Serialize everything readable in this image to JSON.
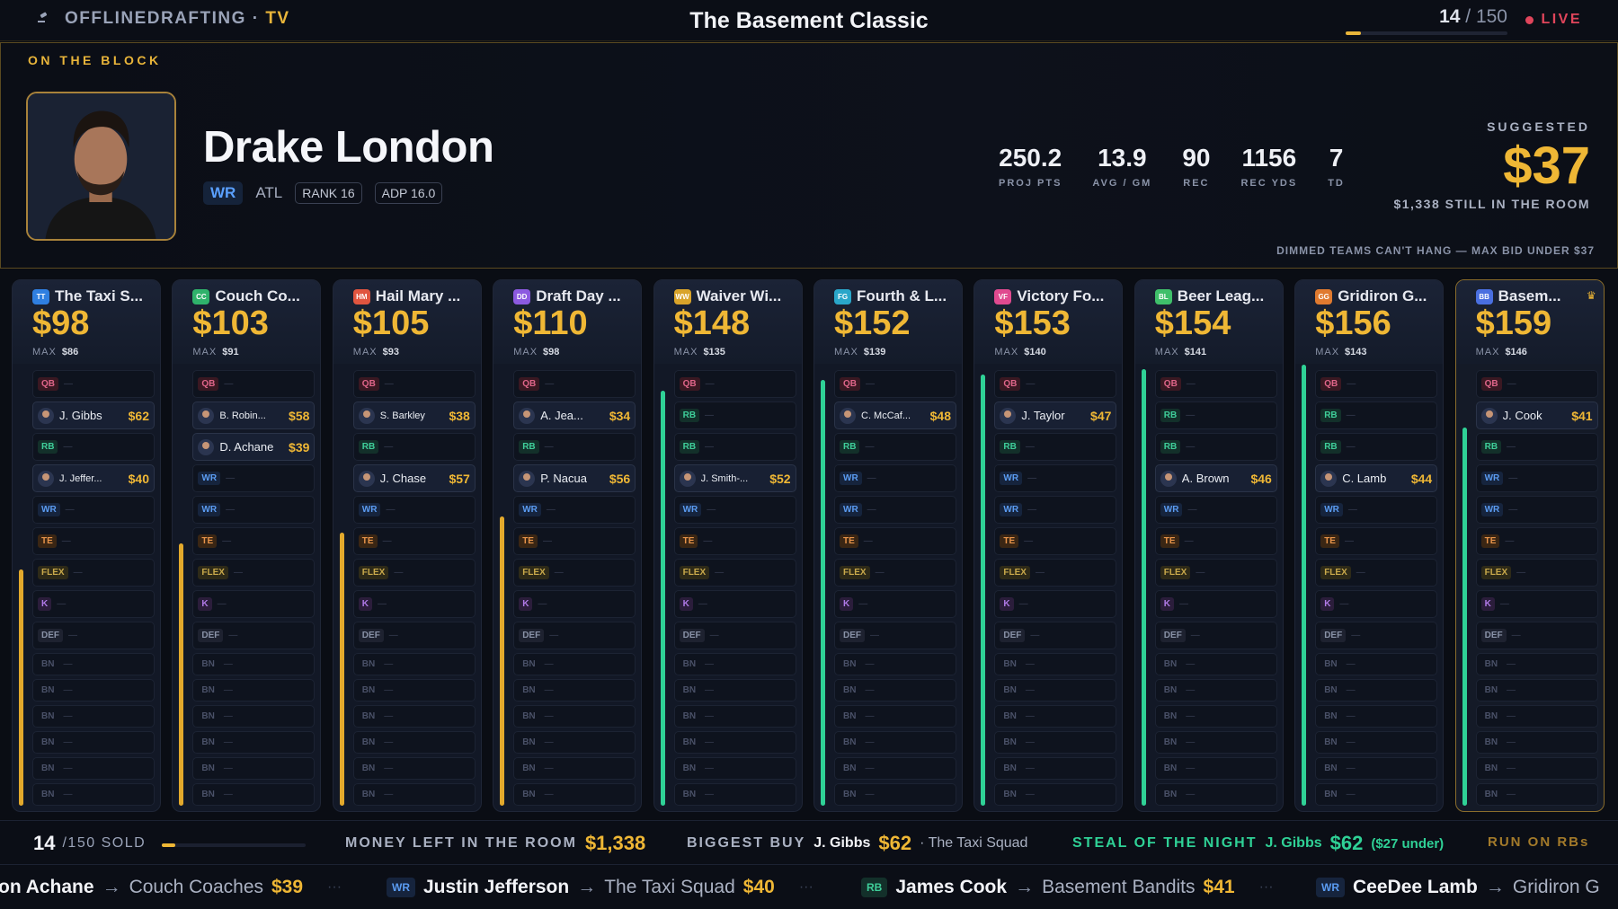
{
  "header": {
    "brand": "OFFLINEDRAFTING",
    "brand_sep": " · ",
    "brand_tv": "TV",
    "title": "The Basement Classic",
    "pick": "14",
    "pick_total": "/ 150",
    "pick_progress": 0.093,
    "live": "LIVE"
  },
  "block": {
    "label": "ON THE BLOCK",
    "player": "Drake London",
    "position": "WR",
    "team": "ATL",
    "rank": "RANK 16",
    "adp": "ADP 16.0",
    "stats": [
      {
        "value": "250.2",
        "label": "PROJ PTS"
      },
      {
        "value": "13.9",
        "label": "AVG / GM"
      },
      {
        "value": "90",
        "label": "REC"
      },
      {
        "value": "1156",
        "label": "REC YDS"
      },
      {
        "value": "7",
        "label": "TD"
      }
    ],
    "suggested_label": "SUGGESTED",
    "suggested": "$37",
    "room": "$1,338 STILL IN THE ROOM",
    "dim_note": "DIMMED TEAMS CAN'T HANG — MAX BID UNDER $37"
  },
  "teams": [
    {
      "abbr": "TT",
      "color": "#2f7fe0",
      "name": "The Taxi S...",
      "budget": "$98",
      "max": "$86",
      "bar": "gold",
      "bar_fill": 0.45,
      "mine": false,
      "slots": [
        {
          "pos": "QB"
        },
        {
          "pos": "RB",
          "player": "J. Gibbs",
          "price": "$62"
        },
        {
          "pos": "RB"
        },
        {
          "pos": "WR",
          "player": "J. Jeffer...",
          "price": "$40",
          "small": true
        },
        {
          "pos": "WR"
        },
        {
          "pos": "TE"
        },
        {
          "pos": "FLEX"
        },
        {
          "pos": "K"
        },
        {
          "pos": "DEF"
        },
        {
          "pos": "BN"
        },
        {
          "pos": "BN"
        },
        {
          "pos": "BN"
        },
        {
          "pos": "BN"
        },
        {
          "pos": "BN"
        },
        {
          "pos": "BN"
        }
      ]
    },
    {
      "abbr": "CC",
      "color": "#2fb26b",
      "name": "Couch Co...",
      "budget": "$103",
      "max": "$91",
      "bar": "gold",
      "bar_fill": 0.5,
      "mine": false,
      "slots": [
        {
          "pos": "QB"
        },
        {
          "pos": "RB",
          "player": "B. Robin...",
          "price": "$58",
          "small": true
        },
        {
          "pos": "RB",
          "player": "D. Achane",
          "price": "$39"
        },
        {
          "pos": "WR"
        },
        {
          "pos": "WR"
        },
        {
          "pos": "TE"
        },
        {
          "pos": "FLEX"
        },
        {
          "pos": "K"
        },
        {
          "pos": "DEF"
        },
        {
          "pos": "BN"
        },
        {
          "pos": "BN"
        },
        {
          "pos": "BN"
        },
        {
          "pos": "BN"
        },
        {
          "pos": "BN"
        },
        {
          "pos": "BN"
        }
      ]
    },
    {
      "abbr": "HM",
      "color": "#e0553f",
      "name": "Hail Mary ...",
      "budget": "$105",
      "max": "$93",
      "bar": "gold",
      "bar_fill": 0.52,
      "mine": false,
      "slots": [
        {
          "pos": "QB"
        },
        {
          "pos": "RB",
          "player": "S. Barkley",
          "price": "$38",
          "small": true
        },
        {
          "pos": "RB"
        },
        {
          "pos": "WR",
          "player": "J. Chase",
          "price": "$57"
        },
        {
          "pos": "WR"
        },
        {
          "pos": "TE"
        },
        {
          "pos": "FLEX"
        },
        {
          "pos": "K"
        },
        {
          "pos": "DEF"
        },
        {
          "pos": "BN"
        },
        {
          "pos": "BN"
        },
        {
          "pos": "BN"
        },
        {
          "pos": "BN"
        },
        {
          "pos": "BN"
        },
        {
          "pos": "BN"
        }
      ]
    },
    {
      "abbr": "DD",
      "color": "#8c5ae0",
      "name": "Draft Day ...",
      "budget": "$110",
      "max": "$98",
      "bar": "gold",
      "bar_fill": 0.55,
      "mine": false,
      "slots": [
        {
          "pos": "QB"
        },
        {
          "pos": "WR",
          "player": "A. Jea...",
          "price": "$34"
        },
        {
          "pos": "RB"
        },
        {
          "pos": "WR",
          "player": "P. Nacua",
          "price": "$56"
        },
        {
          "pos": "WR"
        },
        {
          "pos": "TE"
        },
        {
          "pos": "FLEX"
        },
        {
          "pos": "K"
        },
        {
          "pos": "DEF"
        },
        {
          "pos": "BN"
        },
        {
          "pos": "BN"
        },
        {
          "pos": "BN"
        },
        {
          "pos": "BN"
        },
        {
          "pos": "BN"
        },
        {
          "pos": "BN"
        }
      ]
    },
    {
      "abbr": "WW",
      "color": "#d9a42a",
      "name": "Waiver Wi...",
      "budget": "$148",
      "max": "$135",
      "bar": "green",
      "bar_fill": 0.79,
      "mine": false,
      "slots": [
        {
          "pos": "QB"
        },
        {
          "pos": "RB"
        },
        {
          "pos": "RB"
        },
        {
          "pos": "WR",
          "player": "J. Smith-...",
          "price": "$52",
          "small": true
        },
        {
          "pos": "WR"
        },
        {
          "pos": "TE"
        },
        {
          "pos": "FLEX"
        },
        {
          "pos": "K"
        },
        {
          "pos": "DEF"
        },
        {
          "pos": "BN"
        },
        {
          "pos": "BN"
        },
        {
          "pos": "BN"
        },
        {
          "pos": "BN"
        },
        {
          "pos": "BN"
        },
        {
          "pos": "BN"
        }
      ]
    },
    {
      "abbr": "FG",
      "color": "#2aa6c9",
      "name": "Fourth & L...",
      "budget": "$152",
      "max": "$139",
      "bar": "green",
      "bar_fill": 0.81,
      "mine": false,
      "slots": [
        {
          "pos": "QB"
        },
        {
          "pos": "RB",
          "player": "C. McCaf...",
          "price": "$48",
          "small": true
        },
        {
          "pos": "RB"
        },
        {
          "pos": "WR"
        },
        {
          "pos": "WR"
        },
        {
          "pos": "TE"
        },
        {
          "pos": "FLEX"
        },
        {
          "pos": "K"
        },
        {
          "pos": "DEF"
        },
        {
          "pos": "BN"
        },
        {
          "pos": "BN"
        },
        {
          "pos": "BN"
        },
        {
          "pos": "BN"
        },
        {
          "pos": "BN"
        },
        {
          "pos": "BN"
        }
      ]
    },
    {
      "abbr": "VF",
      "color": "#e04a8f",
      "name": "Victory Fo...",
      "budget": "$153",
      "max": "$140",
      "bar": "green",
      "bar_fill": 0.82,
      "mine": false,
      "slots": [
        {
          "pos": "QB"
        },
        {
          "pos": "RB",
          "player": "J. Taylor",
          "price": "$47"
        },
        {
          "pos": "RB"
        },
        {
          "pos": "WR"
        },
        {
          "pos": "WR"
        },
        {
          "pos": "TE"
        },
        {
          "pos": "FLEX"
        },
        {
          "pos": "K"
        },
        {
          "pos": "DEF"
        },
        {
          "pos": "BN"
        },
        {
          "pos": "BN"
        },
        {
          "pos": "BN"
        },
        {
          "pos": "BN"
        },
        {
          "pos": "BN"
        },
        {
          "pos": "BN"
        }
      ]
    },
    {
      "abbr": "BL",
      "color": "#3fbf6a",
      "name": "Beer Leag...",
      "budget": "$154",
      "max": "$141",
      "bar": "green",
      "bar_fill": 0.83,
      "mine": false,
      "slots": [
        {
          "pos": "QB"
        },
        {
          "pos": "RB"
        },
        {
          "pos": "RB"
        },
        {
          "pos": "WR",
          "player": "A. Brown",
          "price": "$46"
        },
        {
          "pos": "WR"
        },
        {
          "pos": "TE"
        },
        {
          "pos": "FLEX"
        },
        {
          "pos": "K"
        },
        {
          "pos": "DEF"
        },
        {
          "pos": "BN"
        },
        {
          "pos": "BN"
        },
        {
          "pos": "BN"
        },
        {
          "pos": "BN"
        },
        {
          "pos": "BN"
        },
        {
          "pos": "BN"
        }
      ]
    },
    {
      "abbr": "GG",
      "color": "#e07a2f",
      "name": "Gridiron G...",
      "budget": "$156",
      "max": "$143",
      "bar": "green",
      "bar_fill": 0.84,
      "mine": false,
      "slots": [
        {
          "pos": "QB"
        },
        {
          "pos": "RB"
        },
        {
          "pos": "RB"
        },
        {
          "pos": "WR",
          "player": "C. Lamb",
          "price": "$44"
        },
        {
          "pos": "WR"
        },
        {
          "pos": "TE"
        },
        {
          "pos": "FLEX"
        },
        {
          "pos": "K"
        },
        {
          "pos": "DEF"
        },
        {
          "pos": "BN"
        },
        {
          "pos": "BN"
        },
        {
          "pos": "BN"
        },
        {
          "pos": "BN"
        },
        {
          "pos": "BN"
        },
        {
          "pos": "BN"
        }
      ]
    },
    {
      "abbr": "BB",
      "color": "#4a6fe0",
      "name": "Basem...",
      "budget": "$159",
      "max": "$146",
      "bar": "green",
      "bar_fill": 0.72,
      "mine": true,
      "slots": [
        {
          "pos": "QB"
        },
        {
          "pos": "RB",
          "player": "J. Cook",
          "price": "$41"
        },
        {
          "pos": "RB"
        },
        {
          "pos": "WR"
        },
        {
          "pos": "WR"
        },
        {
          "pos": "TE"
        },
        {
          "pos": "FLEX"
        },
        {
          "pos": "K"
        },
        {
          "pos": "DEF"
        },
        {
          "pos": "BN"
        },
        {
          "pos": "BN"
        },
        {
          "pos": "BN"
        },
        {
          "pos": "BN"
        },
        {
          "pos": "BN"
        },
        {
          "pos": "BN"
        }
      ]
    }
  ],
  "team_labels": {
    "max": "MAX",
    "empty": "—"
  },
  "bottom": {
    "sold_n": "14",
    "sold_t": "/150 SOLD",
    "sold_progress": 0.093,
    "money_label": "MONEY LEFT IN THE ROOM",
    "money": "$1,338",
    "biggest_label": "BIGGEST BUY",
    "biggest_player": "J. Gibbs",
    "biggest_price": "$62",
    "biggest_team": "· The Taxi Squad",
    "steal_label": "STEAL OF THE NIGHT",
    "steal_player": "J. Gibbs",
    "steal_price": "$62",
    "steal_under": "($27 under)",
    "run": "RUN ON RBs",
    "ticker": [
      {
        "pos": "",
        "player": "on Achane",
        "team": "Couch Coaches",
        "price": "$39"
      },
      {
        "pos": "WR",
        "player": "Justin Jefferson",
        "team": "The Taxi Squad",
        "price": "$40"
      },
      {
        "pos": "RB",
        "player": "James Cook",
        "team": "Basement Bandits",
        "price": "$41"
      },
      {
        "pos": "WR",
        "player": "CeeDee Lamb",
        "team": "Gridiron G",
        "price": ""
      }
    ]
  }
}
